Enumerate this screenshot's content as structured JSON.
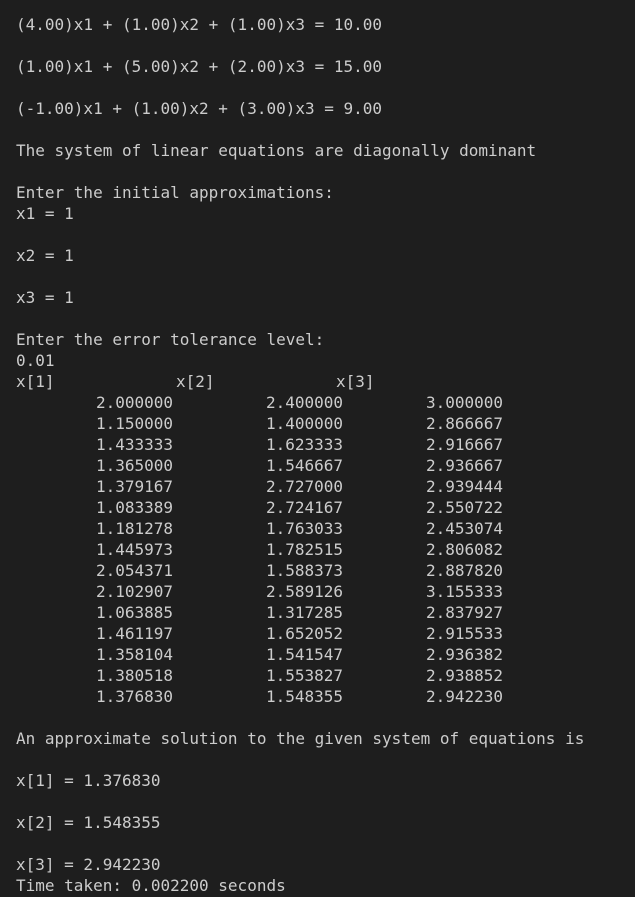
{
  "equations": [
    "(4.00)x1 + (1.00)x2 + (1.00)x3 = 10.00",
    "(1.00)x1 + (5.00)x2 + (2.00)x3 = 15.00",
    "(-1.00)x1 + (1.00)x2 + (3.00)x3 = 9.00"
  ],
  "dominance_message": "The system of linear equations are diagonally dominant",
  "initial_prompt": "Enter the initial approximations:",
  "initial_values": [
    "x1 = 1",
    "x2 = 1",
    "x3 = 1"
  ],
  "tolerance_prompt": "Enter the error tolerance level:",
  "tolerance_value": "0.01",
  "table": {
    "headers": [
      "x[1]",
      "x[2]",
      "x[3]"
    ],
    "rows": [
      [
        "2.000000",
        "2.400000",
        "3.000000"
      ],
      [
        "1.150000",
        "1.400000",
        "2.866667"
      ],
      [
        "1.433333",
        "1.623333",
        "2.916667"
      ],
      [
        "1.365000",
        "1.546667",
        "2.936667"
      ],
      [
        "1.379167",
        "2.727000",
        "2.939444"
      ],
      [
        "1.083389",
        "2.724167",
        "2.550722"
      ],
      [
        "1.181278",
        "1.763033",
        "2.453074"
      ],
      [
        "1.445973",
        "1.782515",
        "2.806082"
      ],
      [
        "2.054371",
        "1.588373",
        "2.887820"
      ],
      [
        "2.102907",
        "2.589126",
        "3.155333"
      ],
      [
        "1.063885",
        "1.317285",
        "2.837927"
      ],
      [
        "1.461197",
        "1.652052",
        "2.915533"
      ],
      [
        "1.358104",
        "1.541547",
        "2.936382"
      ],
      [
        "1.380518",
        "1.553827",
        "2.938852"
      ],
      [
        "1.376830",
        "1.548355",
        "2.942230"
      ]
    ]
  },
  "solution_message": "An approximate solution to the given system of equations is",
  "solutions": [
    "x[1] = 1.376830",
    "x[2] = 1.548355",
    "x[3] = 2.942230"
  ],
  "time_taken": "Time taken: 0.002200 seconds"
}
